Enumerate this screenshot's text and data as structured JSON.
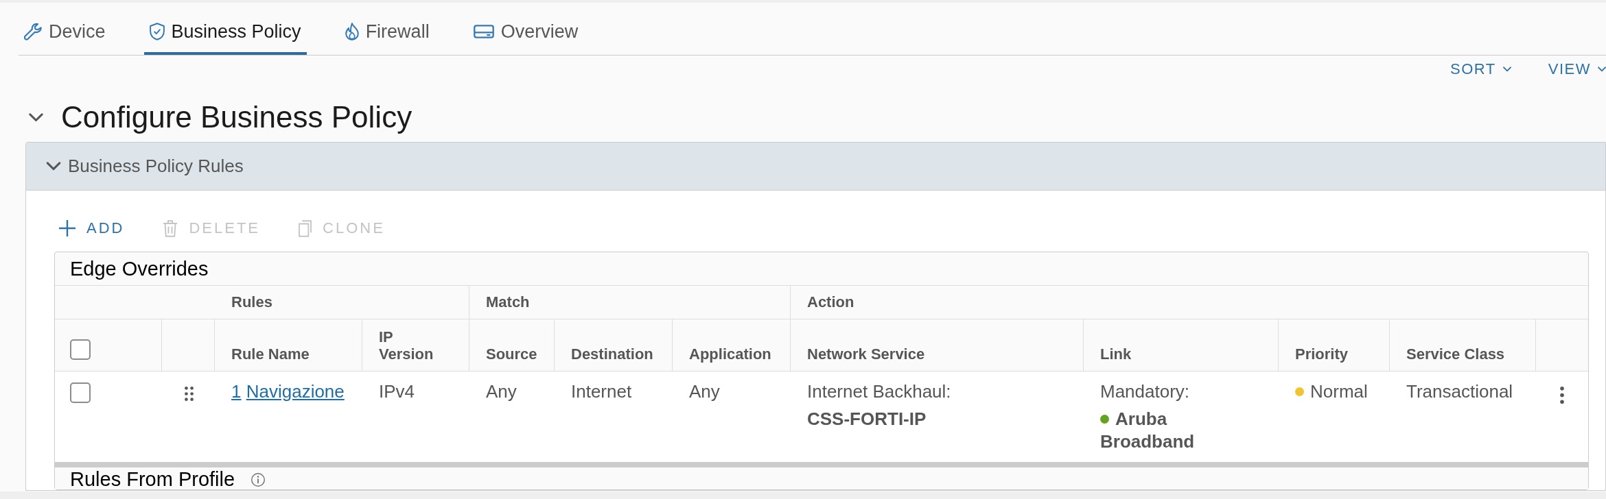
{
  "tabs": [
    {
      "label": "Device",
      "selected": false
    },
    {
      "label": "Business Policy",
      "selected": true
    },
    {
      "label": "Firewall",
      "selected": false
    },
    {
      "label": "Overview",
      "selected": false
    }
  ],
  "view_controls": [
    {
      "label": "SORT"
    },
    {
      "label": "VIEW"
    }
  ],
  "page_header": {
    "title": "Configure Business Policy",
    "expanded": true
  },
  "panel": {
    "title": "Business Policy Rules",
    "expanded": true,
    "toolbar": [
      {
        "label": "ADD",
        "disabled": false
      },
      {
        "label": "DELETE",
        "disabled": true
      },
      {
        "label": "CLONE",
        "disabled": true
      }
    ],
    "table": {
      "title": "Edge Overrides",
      "select_all": {
        "checked": false
      },
      "column_groups": [
        {
          "label": "Rules",
          "columns": [
            "Rule Name",
            "IP Version"
          ]
        },
        {
          "label": "Match",
          "columns": [
            "Source",
            "Destination",
            "Application"
          ]
        },
        {
          "label": "Action",
          "columns": [
            "Network Service",
            "Link",
            "Priority",
            "Service Class"
          ]
        }
      ],
      "rows": [
        {
          "checked": false,
          "rule": {
            "number": "1",
            "name": "Navigazione"
          },
          "ip_version": "IPv4",
          "source": "Any",
          "destination": "Internet",
          "application": "Any",
          "network_service": {
            "label": "Internet Backhaul:",
            "name": "CSS-FORTI-IP"
          },
          "link": {
            "label": "Mandatory:",
            "name": "Aruba Broadband",
            "color": "#62a420"
          },
          "priority": {
            "label": "Normal",
            "color": "#f0c530"
          },
          "service_class": "Transactional"
        }
      ]
    },
    "profile_section": {
      "title": "Rules From Profile"
    }
  }
}
